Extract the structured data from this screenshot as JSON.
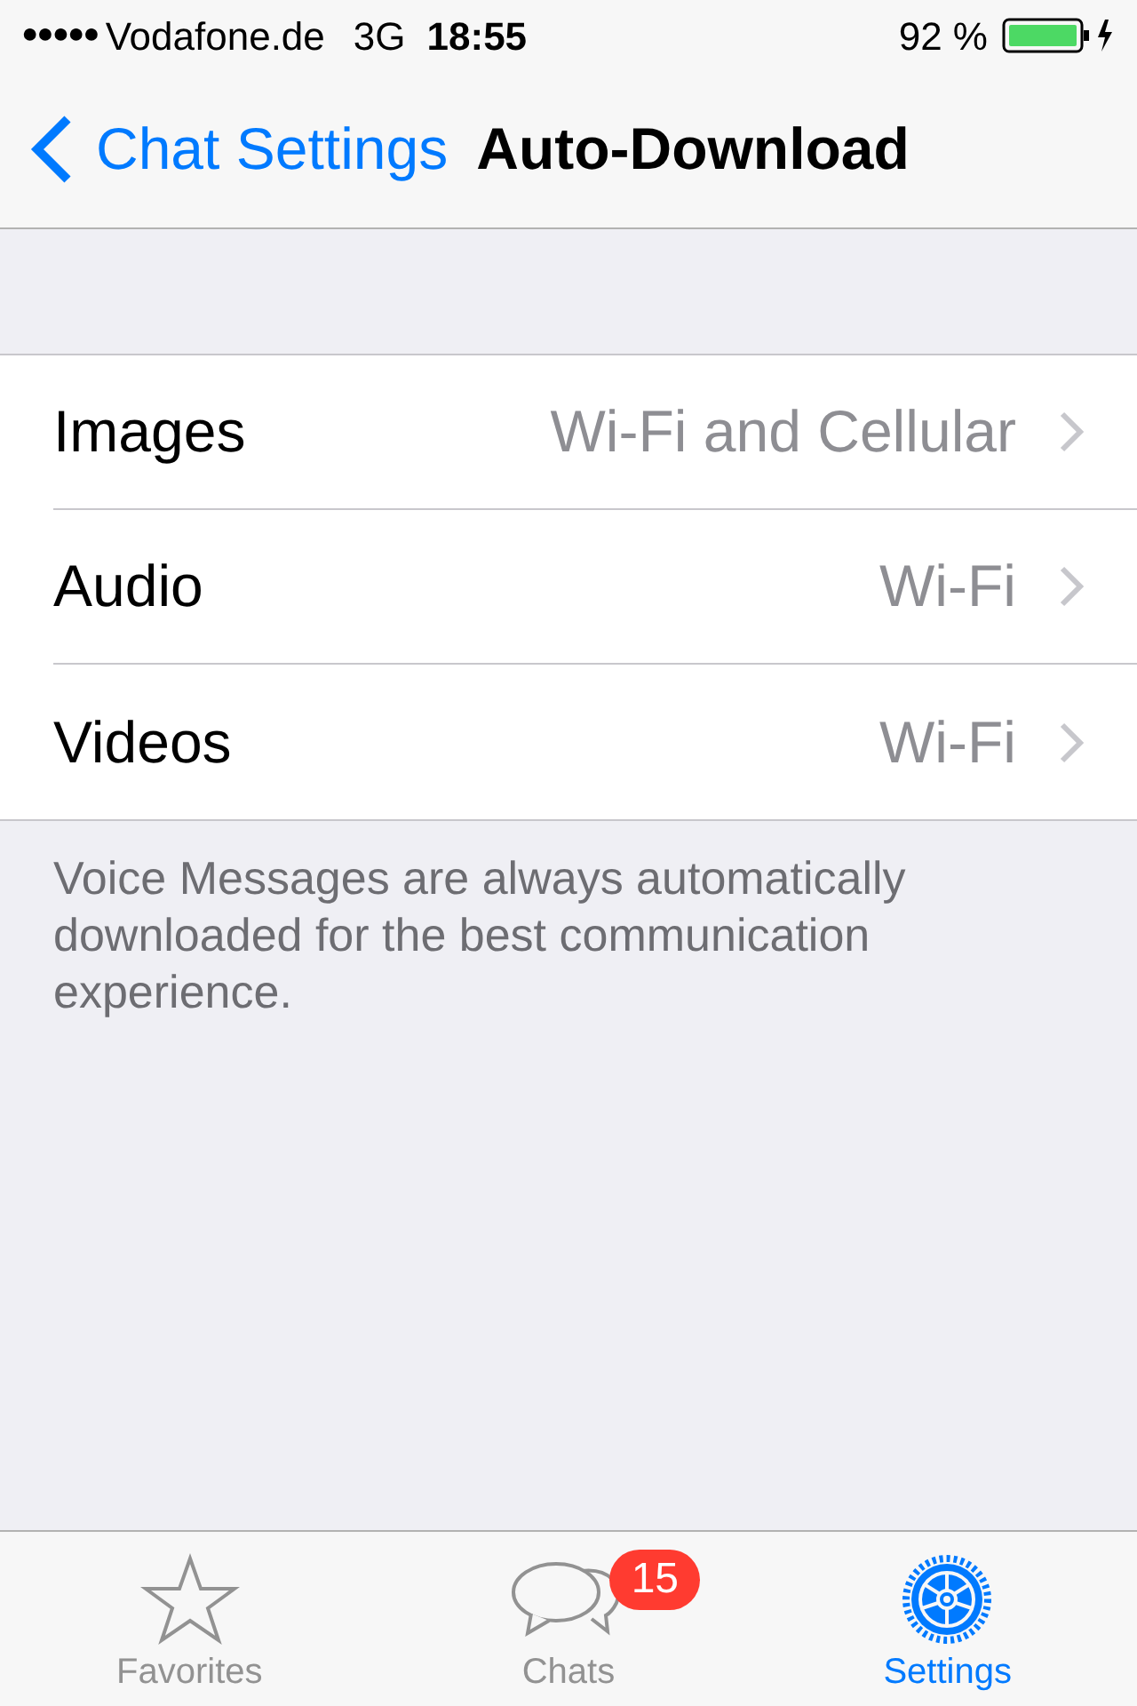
{
  "status_bar": {
    "signal": "●●●●●",
    "carrier": "Vodafone.de",
    "network": "3G",
    "time": "18:55",
    "battery": "92 %"
  },
  "nav": {
    "back": "Chat Settings",
    "title": "Auto-Download"
  },
  "rows": [
    {
      "label": "Images",
      "value": "Wi-Fi and Cellular"
    },
    {
      "label": "Audio",
      "value": "Wi-Fi"
    },
    {
      "label": "Videos",
      "value": "Wi-Fi"
    }
  ],
  "footer": "Voice Messages are always automatically downloaded for the best communication experience.",
  "tabs": [
    {
      "kind": "star",
      "label": "Favorites",
      "selected": false
    },
    {
      "kind": "chats",
      "label": "Chats",
      "badge": "15",
      "selected": false
    },
    {
      "kind": "gear",
      "label": "Settings",
      "selected": true
    }
  ]
}
